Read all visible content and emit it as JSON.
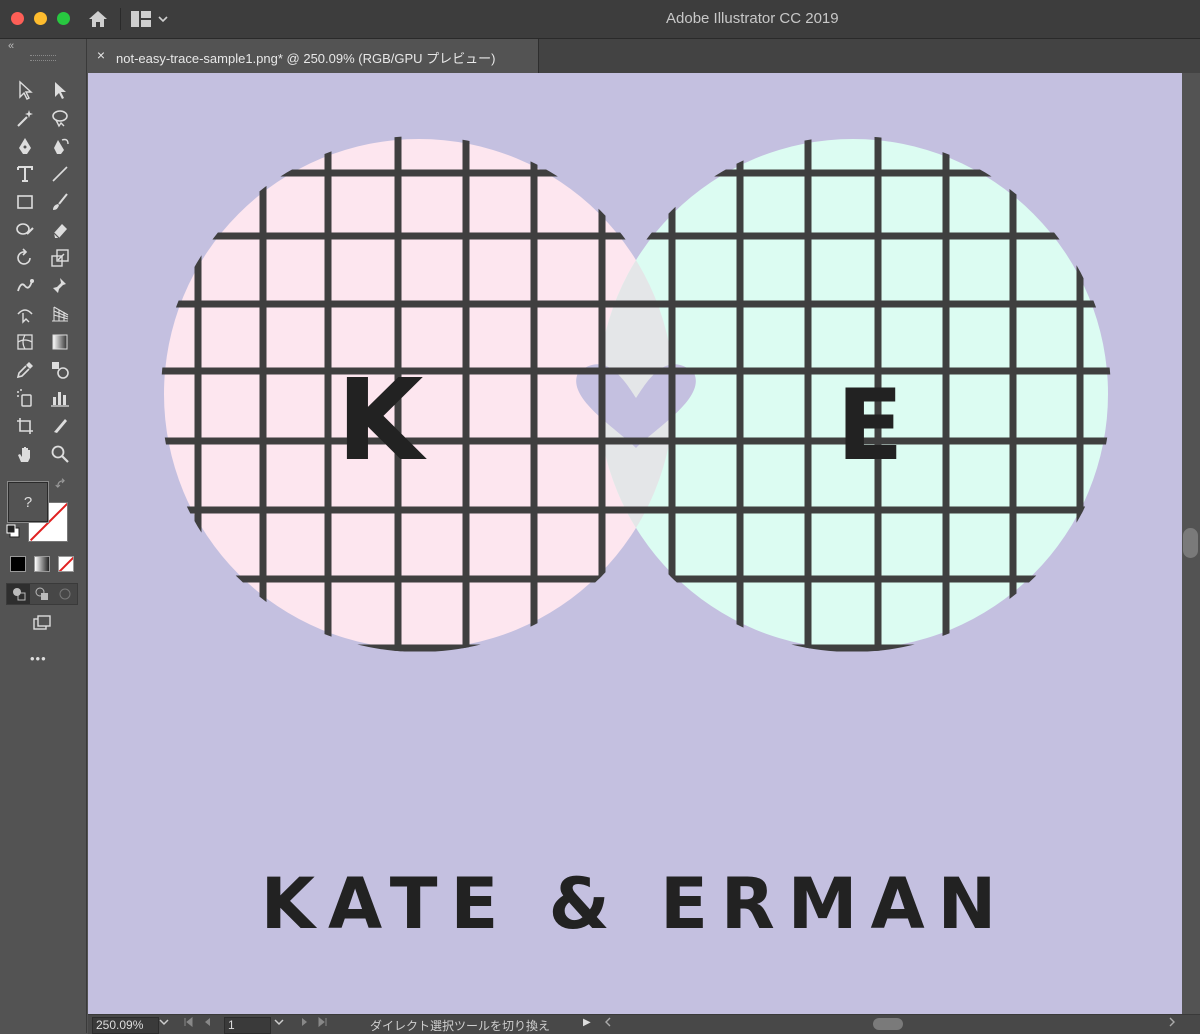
{
  "window": {
    "title": "Adobe Illustrator CC 2019"
  },
  "tab": {
    "close_glyph": "×",
    "label": "not-easy-trace-sample1.png* @ 250.09% (RGB/GPU プレビュー)"
  },
  "toolbar": {
    "collapse_glyph": "«",
    "tools": [
      "selection-tool",
      "direct-selection-tool",
      "magic-wand-tool",
      "lasso-tool",
      "pen-tool",
      "curvature-tool",
      "type-tool",
      "line-segment-tool",
      "rectangle-tool",
      "paintbrush-tool",
      "shaper-tool",
      "eraser-tool",
      "rotate-tool",
      "scale-tool",
      "puppet-warp-tool",
      "pin-tool",
      "free-transform-tool",
      "perspective-grid-tool",
      "mesh-tool",
      "gradient-tool",
      "eyedropper-tool",
      "blend-tool",
      "symbol-sprayer-tool",
      "column-graph-tool",
      "artboard-tool",
      "slice-tool",
      "hand-tool",
      "zoom-tool"
    ],
    "fill_label": "?",
    "more_label": "•••"
  },
  "artwork": {
    "letter_left": "K",
    "letter_right": "E",
    "caption": "KATE & ERMAN",
    "colors": {
      "background": "#c4c0e0",
      "left_circle": "#fde6ef",
      "right_circle": "#dcfcf2",
      "overlap": "#e4e6e8",
      "grid_lines": "#3f3f3f",
      "text": "#222222"
    }
  },
  "statusbar": {
    "zoom": "250.09%",
    "page": "1",
    "message": "ダイレクト選択ツールを切り換え",
    "play_glyph": "▶"
  }
}
